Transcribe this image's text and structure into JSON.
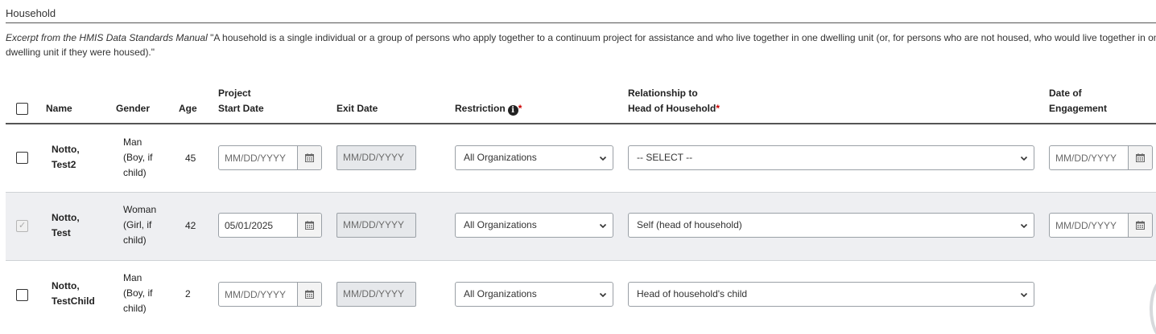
{
  "section": {
    "title": "Household",
    "excerpt_label": "Excerpt from the HMIS Data Standards Manual",
    "excerpt_text": " \"A household is a single individual or a group of persons who apply together to a continuum project for assistance and who live together in one dwelling unit (or, for persons who are not housed, who would live together in one dwelling unit if they were housed).\""
  },
  "headers": {
    "name": "Name",
    "gender": "Gender",
    "age": "Age",
    "project_start_1": "Project",
    "project_start_2": "Start Date",
    "exit_date": "Exit Date",
    "restriction": "Restriction",
    "relationship_1": "Relationship to",
    "relationship_2": "Head of Household",
    "required_mark": "*",
    "engagement_1": "Date of",
    "engagement_2": "Engagement"
  },
  "date_placeholder": "MM/DD/YYYY",
  "rows": [
    {
      "name_line1": "Notto,",
      "name_line2": "Test2",
      "gender_line1": "Man",
      "gender_line2": "(Boy, if",
      "gender_line3": "child)",
      "age": "45",
      "start_date": "",
      "exit_date": "MM/DD/YYYY",
      "restriction": "All Organizations",
      "relationship": "-- SELECT --",
      "engagement_date": "",
      "checked": false
    },
    {
      "name_line1": "Notto,",
      "name_line2": "Test",
      "gender_line1": "Woman",
      "gender_line2": "(Girl, if",
      "gender_line3": "child)",
      "age": "42",
      "start_date": "05/01/2025",
      "exit_date": "MM/DD/YYYY",
      "restriction": "All Organizations",
      "relationship": "Self (head of household)",
      "engagement_date": "",
      "checked": true
    },
    {
      "name_line1": "Notto,",
      "name_line2": "TestChild",
      "gender_line1": "Man",
      "gender_line2": "(Boy, if",
      "gender_line3": "child)",
      "age": "2",
      "start_date": "",
      "exit_date": "MM/DD/YYYY",
      "restriction": "All Organizations",
      "relationship": "Head of household's child",
      "checked": false
    }
  ],
  "icons": {
    "calendar": "calendar-icon",
    "chevron": "chevron-down-icon",
    "info": "info-icon"
  }
}
